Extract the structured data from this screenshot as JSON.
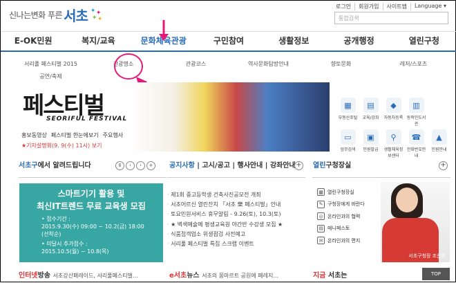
{
  "logo": {
    "slogan": "신나는변화 푸른",
    "name": "서초"
  },
  "util": [
    "로그인",
    "회원가입",
    "사이트맵",
    "Language ▾"
  ],
  "search": {
    "placeholder": "통합검색"
  },
  "gnb": [
    "E-OK민원",
    "복지/교육",
    "문화체육관광",
    "구민참여",
    "생활정보",
    "공개행정",
    "열린구청"
  ],
  "submenu": [
    "서리풀 페스티벌 2015",
    "관광명소",
    "관광코스",
    "역사문화탐방안내",
    "향토문화",
    "레저/스포츠",
    "공연/축제"
  ],
  "banner": {
    "title": "페스티벌",
    "subtitle": "SEORIFUL FESTIVAL",
    "links": [
      "홍보동영상",
      "페스티벌 한눈에보기",
      "주요행사"
    ],
    "note": "★기자설명회(9. 9(수) 11시) 보기"
  },
  "quick": [
    "부동산포털",
    "교육/강좌",
    "자동차등록",
    "동적인도서관",
    "",
    "업무검색",
    "민원발급",
    "생활체육정보센터",
    "전화번호안내",
    "인원안내"
  ],
  "seocho_news": {
    "prefix": "서초구",
    "suffix": "에서 알려드립니다"
  },
  "tabs": [
    "공지사항",
    "고시/공고",
    "행사안내",
    "강좌안내"
  ],
  "edu": {
    "t1": "스마트기기 활용 및",
    "t2": "최신IT트렌드 무료 교육생 모집",
    "d1": "• 접수기간 :",
    "d2": "2015.9.30(수) 09:00 ~ 10.2(금) 18:00",
    "d3": "(선착순)",
    "d4": "• 미달시 추가접수 :",
    "d5": "2015.10.5(월) ~ 10.8(목)"
  },
  "news": [
    "제1회 중고등학생 건축사진공모전 개최",
    "서초어르신 열린잔치 「서초 樂 페스티벌」안내",
    "토요민원서비스 휴무알림 - 9.26(토), 10.3(토)",
    "★ 벽색예술메 평생교육원 야간반 수강생 모집 ★",
    "식품접객업소 위생점검 사전예고",
    "서리풀 페스티벌 특집 스크랩 이벤트"
  ],
  "civil": {
    "head_prefix": "열린",
    "head_suffix": "구청장실",
    "items": [
      "열린구청장실",
      "구청장에게 바란다",
      "온라인과의 협력",
      "매니페스토",
      "온라인과의 편지"
    ]
  },
  "mayor_caption": "서초구청장 조은희",
  "bottom": [
    {
      "prefix": "인터넷",
      "suffix": "방송",
      "rest": "서초강산패레이드, 서리풀페스티벌..."
    },
    {
      "prefix": "e서초",
      "suffix": "뉴스",
      "rest": "서초의 몽마르트 공원에 페레지..."
    },
    {
      "prefix": "지금",
      "suffix": " 서초는",
      "rest": ""
    }
  ],
  "page_top": "TOP",
  "colors": {
    "accent": "#2a6cb8",
    "highlight": "#e8177a",
    "teal": "#38a7a3"
  }
}
